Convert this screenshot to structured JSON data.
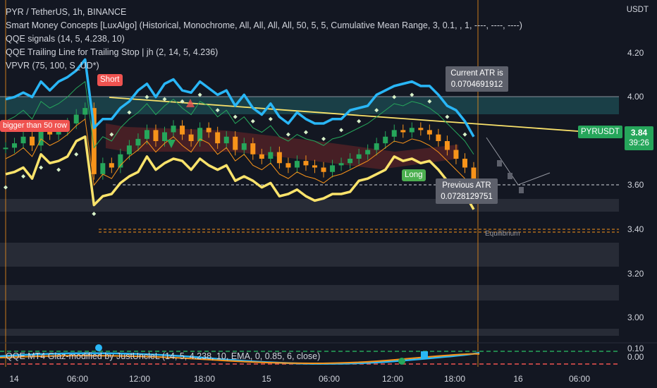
{
  "legend": {
    "symbol": "PYR / TetherUS, 1h, BINANCE",
    "indicators": [
      "Smart Money Concepts [LuxAlgo] (Historical, Monochrome, All, All, All, All, 50, 5, 5, Cumulative Mean Range, 3, 0.1, , 1, ----, ----, ----)",
      "QQE signals (14, 5, 4.238, 10)",
      "QQE Trailing Line for Trailing Stop | jh (2, 14, 5, 4.236)",
      "VPVR (75, 100, S_UD*)"
    ],
    "sub_indicator": "QQE MT4 Glaz-modified by JustUncleL (14, 5, 4.238, 10, EMA, 0, 0.85, 6, close)"
  },
  "axis": {
    "currency": "USDT",
    "price_ticks": [
      "4.20",
      "4.00",
      "3.60",
      "3.40",
      "3.20",
      "3.00"
    ],
    "sub_ticks": [
      "0.10",
      "0.00"
    ],
    "time_ticks": [
      "14",
      "06:00",
      "12:00",
      "18:00",
      "15",
      "06:00",
      "12:00",
      "18:00",
      "16",
      "06:00"
    ]
  },
  "last_price": {
    "symbol": "PYRUSDT",
    "price": "3.84",
    "countdown": "39:26"
  },
  "annotations": {
    "current_atr": "Current ATR is 0.0704691912",
    "current_atr_line1": "Current ATR is",
    "current_atr_line2": "0.0704691912",
    "previous_atr_line1": "Previous ATR",
    "previous_atr_line2": "0.0728129751",
    "short_label": "Short",
    "long_label": "Long",
    "equilibrium": "Equilibrium",
    "bigger_label": "bigger than 50 row"
  },
  "colors": {
    "background": "#131722",
    "up": "#26a65b",
    "down": "#f7931a",
    "qqe_blue": "#29b6f6",
    "qqe_yellow": "#fbe36b",
    "short": "#ef5350"
  },
  "chart_data": {
    "type": "candlestick",
    "xlabel": "",
    "ylabel": "",
    "ylim": [
      2.92,
      4.27
    ],
    "last_price": 3.84,
    "x": [
      "14",
      "06:00",
      "12:00",
      "18:00",
      "15",
      "06:00",
      "12:00",
      "18:00",
      "16",
      "06:00"
    ],
    "series": [
      {
        "values": [
          3.77,
          3.79,
          3.82,
          3.78,
          3.86,
          3.83,
          3.85,
          3.88,
          3.92,
          3.95,
          3.65,
          3.7,
          3.68,
          3.74,
          3.78,
          3.81,
          3.85,
          3.8,
          3.84,
          3.87,
          3.83,
          3.8,
          3.86,
          3.84,
          3.79,
          3.82,
          3.76,
          3.79,
          3.74,
          3.72,
          3.75,
          3.7,
          3.68,
          3.71,
          3.69,
          3.68,
          3.66,
          3.69,
          3.7,
          3.72,
          3.74,
          3.76,
          3.79,
          3.82,
          3.85,
          3.84,
          3.86,
          3.85,
          3.83,
          3.8,
          3.76,
          3.72,
          3.68,
          3.62
        ]
      }
    ]
  }
}
